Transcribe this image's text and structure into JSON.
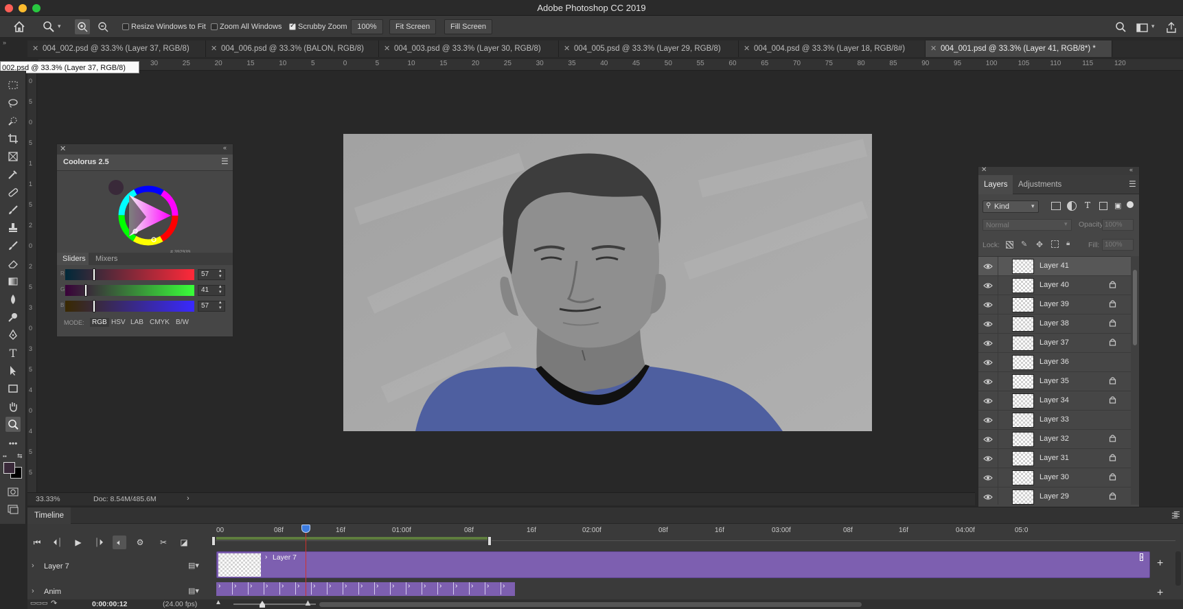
{
  "app": {
    "title": "Adobe Photoshop CC 2019"
  },
  "colors": {
    "accent_purple": "#7d5fb0",
    "shirt_blue": "#4e5fa0",
    "playhead": "#d0312d",
    "canvas_bg": "#282828"
  },
  "options_bar": {
    "resize_windows_label": "Resize Windows to Fit",
    "resize_windows_checked": false,
    "zoom_all_label": "Zoom All Windows",
    "zoom_all_checked": false,
    "scrubby_zoom_label": "Scrubby Zoom",
    "scrubby_zoom_checked": true,
    "zoom_value": "100%",
    "fit_screen_label": "Fit Screen",
    "fill_screen_label": "Fill Screen"
  },
  "tabs": [
    {
      "label": "004_002.psd @ 33.3% (Layer 37, RGB/8)",
      "active": false
    },
    {
      "label": "004_006.psd @ 33.3% (BALON, RGB/8)",
      "active": false
    },
    {
      "label": "004_003.psd @ 33.3% (Layer 30, RGB/8)",
      "active": false
    },
    {
      "label": "004_005.psd @ 33.3% (Layer 29, RGB/8)",
      "active": false
    },
    {
      "label": "004_004.psd @ 33.3% (Layer 18, RGB/8#)",
      "active": false
    },
    {
      "label": "004_001.psd @ 33.3% (Layer 41, RGB/8*) *",
      "active": true
    }
  ],
  "tooltip": "002.psd @ 33.3% (Layer 37, RGB/8)",
  "ruler": {
    "h_ticks": [
      "30",
      "25",
      "20",
      "15",
      "10",
      "5",
      "0",
      "5",
      "10",
      "15",
      "20",
      "25",
      "30",
      "35",
      "40",
      "45",
      "50",
      "55",
      "60",
      "65",
      "70",
      "75",
      "80",
      "85",
      "90",
      "95",
      "100",
      "105",
      "110",
      "115",
      "120"
    ],
    "v_ticks": [
      "0",
      "5",
      "0",
      "5",
      "1",
      "1",
      "5",
      "2",
      "0",
      "2",
      "5",
      "3",
      "0",
      "3",
      "5",
      "4",
      "0",
      "4",
      "5",
      "5"
    ]
  },
  "coolorus": {
    "title": "Coolorus 2.5",
    "hex_label": "# 392939",
    "tabs": [
      "Sliders",
      "Mixers"
    ],
    "active_tab": "Sliders",
    "sliders": [
      {
        "channel": "R",
        "value": "57",
        "fraction": 0.224
      },
      {
        "channel": "G",
        "value": "41",
        "fraction": 0.161
      },
      {
        "channel": "B",
        "value": "57",
        "fraction": 0.224
      }
    ],
    "mode_label": "MODE:",
    "modes": [
      "RGB",
      "HSV",
      "LAB",
      "CMYK",
      "B/W"
    ],
    "active_mode": "RGB"
  },
  "layers_panel": {
    "tabs": [
      "Layers",
      "Adjustments"
    ],
    "filter_kind": "Kind",
    "blend_mode": "Normal",
    "opacity_label": "Opacity:",
    "opacity_value": "100%",
    "lock_label": "Lock:",
    "fill_label": "Fill:",
    "fill_value": "100%",
    "layers": [
      {
        "name": "Layer 41",
        "locked": false,
        "selected": true
      },
      {
        "name": "Layer 40",
        "locked": true,
        "selected": false
      },
      {
        "name": "Layer 39",
        "locked": true,
        "selected": false
      },
      {
        "name": "Layer 38",
        "locked": true,
        "selected": false
      },
      {
        "name": "Layer 37",
        "locked": true,
        "selected": false
      },
      {
        "name": "Layer 36",
        "locked": false,
        "selected": false
      },
      {
        "name": "Layer 35",
        "locked": true,
        "selected": false
      },
      {
        "name": "Layer 34",
        "locked": true,
        "selected": false
      },
      {
        "name": "Layer 33",
        "locked": false,
        "selected": false
      },
      {
        "name": "Layer 32",
        "locked": true,
        "selected": false
      },
      {
        "name": "Layer 31",
        "locked": true,
        "selected": false
      },
      {
        "name": "Layer 30",
        "locked": true,
        "selected": false
      },
      {
        "name": "Layer 29",
        "locked": true,
        "selected": false
      }
    ]
  },
  "status_bar": {
    "zoom": "33.33%",
    "doc": "Doc: 8.54M/485.6M"
  },
  "timeline": {
    "title": "Timeline",
    "time_marks": [
      "00",
      "08f",
      "16f",
      "01:00f",
      "08f",
      "16f",
      "02:00f",
      "08f",
      "16f",
      "03:00f",
      "08f",
      "16f",
      "04:00f",
      "05:0"
    ],
    "tracks": [
      {
        "name": "Layer 7",
        "clip_label": "Layer 7"
      },
      {
        "name": "Anim"
      }
    ],
    "timecode": "0:00:00:12",
    "fps": "(24.00 fps)"
  }
}
